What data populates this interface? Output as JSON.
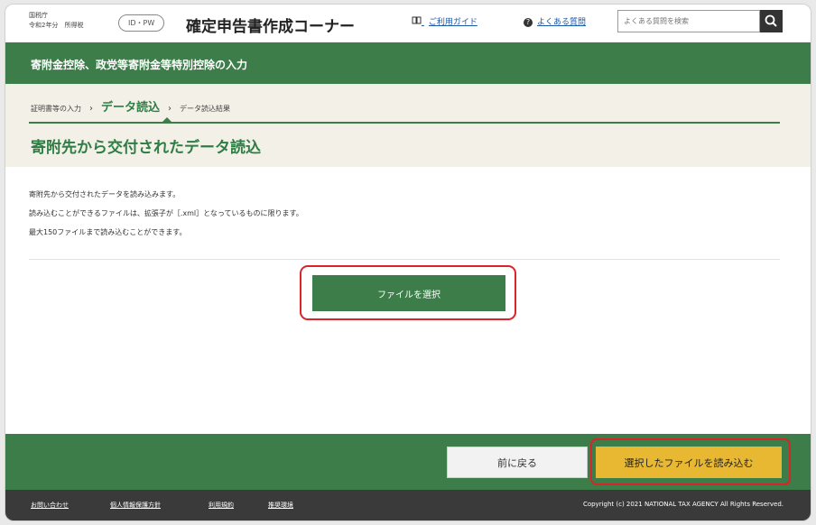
{
  "header": {
    "agency": "国税庁",
    "tax_year": "令和2年分　所得税",
    "login_badge": "ID・PW",
    "app_title": "確定申告書作成コーナー",
    "guide_link": "ご利用ガイド",
    "faq_link": "よくある質問",
    "search_placeholder": "よくある質問を検索"
  },
  "section_title": "寄附金控除、政党等寄附金等特別控除の入力",
  "breadcrumb": {
    "items": [
      "証明書等の入力",
      "データ読込",
      "データ読込結果"
    ],
    "current_index": 1
  },
  "page_title": "寄附先から交付されたデータ読込",
  "description": [
    "寄附先から交付されたデータを読み込みます。",
    "読み込むことができるファイルは、拡張子が［.xml］となっているものに限ります。",
    "最大150ファイルまで読み込むことができます。"
  ],
  "buttons": {
    "select_file": "ファイルを選択",
    "back": "前に戻る",
    "load_selected": "選択したファイルを読み込む"
  },
  "footer": {
    "links": [
      "お問い合わせ",
      "個人情報保護方針",
      "利用規約",
      "推奨環境"
    ],
    "copyright": "Copyright (c) 2021 NATIONAL TAX AGENCY All Rights Reserved."
  },
  "colors": {
    "brand_green": "#3c7d4a",
    "highlight_red": "#d9242a",
    "primary_action_yellow": "#e8b832"
  },
  "icons": [
    "book-icon",
    "question-circle-icon",
    "search-icon",
    "chevron-right-icon"
  ]
}
